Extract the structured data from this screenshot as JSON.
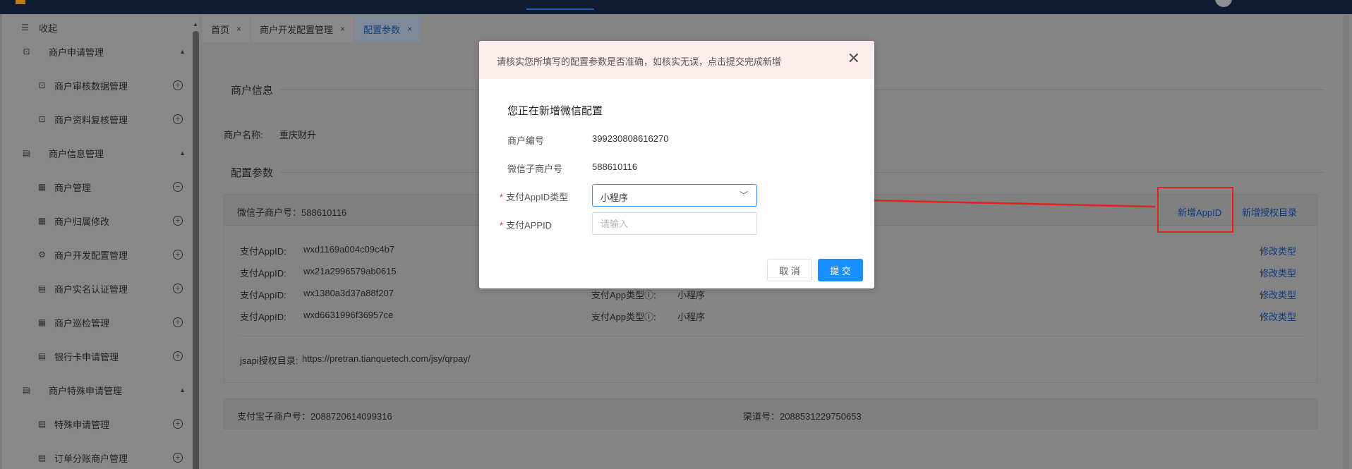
{
  "sidebar": {
    "collapse_label": "收起",
    "items": [
      {
        "label": "商户申请管理",
        "type": "group",
        "icon": "doc-search-icon"
      },
      {
        "label": "商户审核数据管理",
        "type": "sub",
        "icon": "doc-search-icon"
      },
      {
        "label": "商户资料复核管理",
        "type": "sub",
        "icon": "doc-search-icon"
      },
      {
        "label": "商户信息管理",
        "type": "group",
        "icon": "doc-icon"
      },
      {
        "label": "商户管理",
        "type": "sub",
        "icon": "store-icon",
        "expander": "⊖"
      },
      {
        "label": "商户归属修改",
        "type": "sub",
        "icon": "store-icon"
      },
      {
        "label": "商户开发配置管理",
        "type": "sub",
        "icon": "settings-icon"
      },
      {
        "label": "商户实名认证管理",
        "type": "sub",
        "icon": "list-icon"
      },
      {
        "label": "商户巡检管理",
        "type": "sub",
        "icon": "store-icon"
      },
      {
        "label": "银行卡申请管理",
        "type": "sub",
        "icon": "list-icon"
      },
      {
        "label": "商户特殊申请管理",
        "type": "group",
        "icon": "doc-icon"
      },
      {
        "label": "特殊申请管理",
        "type": "sub",
        "icon": "list-icon"
      },
      {
        "label": "订单分账商户管理",
        "type": "sub",
        "icon": "list-icon"
      }
    ]
  },
  "tabs": [
    {
      "label": "首页",
      "active": false
    },
    {
      "label": "商户开发配置管理",
      "active": false
    },
    {
      "label": "配置参数",
      "active": true
    }
  ],
  "main": {
    "merchant_info_title": "商户信息",
    "merchant_name_label": "商户名称:",
    "merchant_name_value": "重庆财升",
    "config_title": "配置参数",
    "wechat_box": {
      "header": "微信子商户号：588610116",
      "add_appid": "新增AppID",
      "add_auth_dir": "新增授权目录",
      "rows": [
        {
          "label": "支付AppID:",
          "value": "wxd1169a004c09c4b7",
          "type_label": "",
          "type_value": "",
          "action": "修改类型"
        },
        {
          "label": "支付AppID:",
          "value": "wx21a2996579ab0615",
          "type_label": "",
          "type_value": "",
          "action": "修改类型"
        },
        {
          "label": "支付AppID:",
          "value": "wx1380a3d37a88f207",
          "type_label": "支付App类型ⓘ:",
          "type_value": "小程序",
          "action": "修改类型"
        },
        {
          "label": "支付AppID:",
          "value": "wxd6631996f36957ce",
          "type_label": "支付App类型ⓘ:",
          "type_value": "小程序",
          "action": "修改类型"
        }
      ],
      "jsapi_label": "jsapi授权目录:",
      "jsapi_value": "https://pretran.tianquetech.com/jsy/qrpay/"
    },
    "alipay_box": {
      "merchant_label": "支付宝子商户号：2088720614099316",
      "channel_label": "渠道号：2088531229750653"
    }
  },
  "modal": {
    "warning": "请核实您所填写的配置参数是否准确，如核实无误，点击提交完成新增",
    "subtitle": "您正在新增微信配置",
    "merchant_no_label": "商户编号",
    "merchant_no_value": "399230808616270",
    "wechat_sub_label": "微信子商户号",
    "wechat_sub_value": "588610116",
    "appid_type_label": "支付AppID类型",
    "appid_type_value": "小程序",
    "appid_label": "支付APPID",
    "appid_placeholder": "请输入",
    "appid_value": "",
    "cancel_label": "取 消",
    "submit_label": "提 交"
  },
  "colors": {
    "topbar": "#0e1b33",
    "primary": "#1890ff",
    "annotation": "#e52020",
    "warning_bg": "#fdecec"
  }
}
